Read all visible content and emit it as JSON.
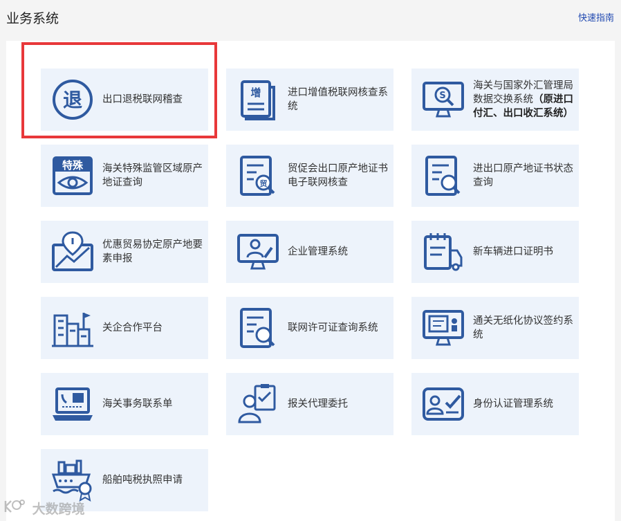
{
  "header": {
    "title": "业务系统",
    "quick_link": "快速指南"
  },
  "cards": [
    {
      "label": "出口退税联网稽查",
      "icon": "refund-icon",
      "icon_text": "退"
    },
    {
      "label": "进口增值税联网核查系统",
      "icon": "vat-document-icon",
      "icon_text": "增"
    },
    {
      "label_main": "海关与国家外汇管理局数据交换系统",
      "label_bold": "（原进口付汇、出口收汇系统）",
      "icon": "monitor-search-icon"
    },
    {
      "label": "海关特殊监管区域原产地证查询",
      "icon": "special-zone-eye-icon",
      "icon_text": "特殊"
    },
    {
      "label": "贸促会出口原产地证书电子联网核查",
      "icon": "trade-document-icon",
      "icon_text": "贸"
    },
    {
      "label": "进出口原产地证书状态查询",
      "icon": "document-search-icon"
    },
    {
      "label": "优惠贸易协定原产地要素申报",
      "icon": "map-pin-chart-icon"
    },
    {
      "label": "企业管理系统",
      "icon": "user-monitor-icon"
    },
    {
      "label": "新车辆进口证明书",
      "icon": "vehicle-calendar-icon"
    },
    {
      "label": "关企合作平台",
      "icon": "buildings-icon"
    },
    {
      "label": "联网许可证查询系统",
      "icon": "license-search-icon"
    },
    {
      "label": "通关无纸化协议签约系统",
      "icon": "id-monitor-icon"
    },
    {
      "label": "海关事务联系单",
      "icon": "laptop-contact-icon"
    },
    {
      "label": "报关代理委托",
      "icon": "agent-clipboard-icon"
    },
    {
      "label": "身份认证管理系统",
      "icon": "identity-check-icon"
    },
    {
      "label": "船舶吨税执照申请",
      "icon": "ship-badge-icon"
    }
  ],
  "watermark": {
    "text": "大数跨境"
  },
  "colors": {
    "accent": "#2f5aa0",
    "card_bg": "#edf3fb",
    "highlight": "#e8383a",
    "link": "#1f48b0"
  }
}
